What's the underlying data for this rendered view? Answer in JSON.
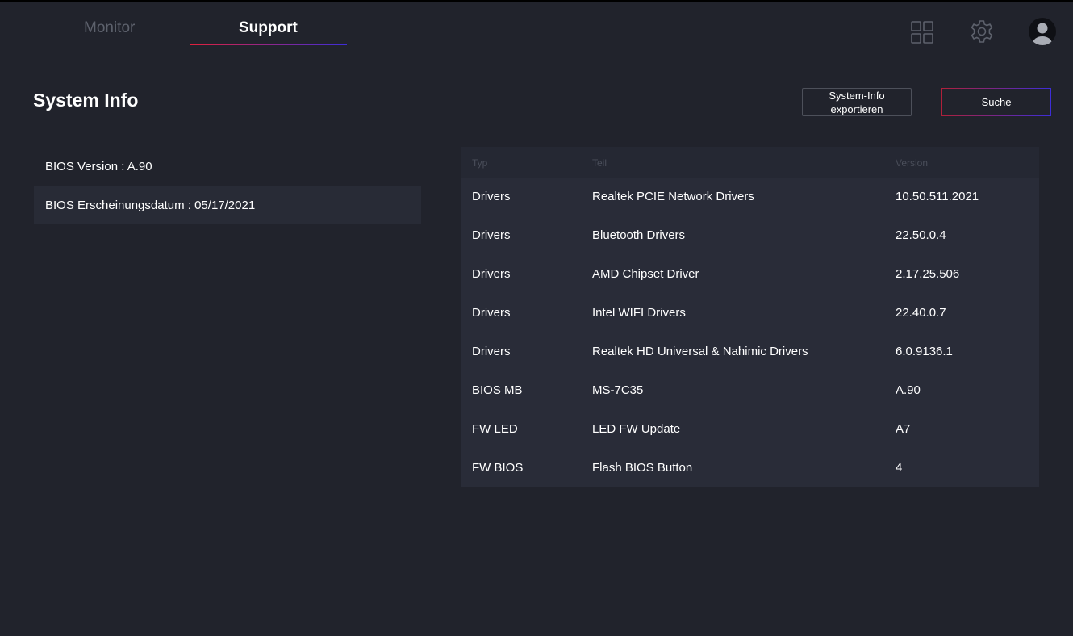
{
  "nav": {
    "tabs": [
      {
        "label": "Monitor"
      },
      {
        "label": "Support"
      }
    ],
    "active_tab": "Support",
    "icons": [
      "grid-icon",
      "gear-icon",
      "avatar-icon"
    ]
  },
  "header": {
    "title": "System Info",
    "export_label_line1": "System-Info",
    "export_label_line2": "exportieren",
    "search_label": "Suche"
  },
  "bios_info": [
    {
      "text": "BIOS Version : A.90"
    },
    {
      "text": "BIOS Erscheinungsdatum : 05/17/2021"
    }
  ],
  "table": {
    "columns": [
      "Typ",
      "Teil",
      "Version"
    ],
    "rows": [
      {
        "typ": "Drivers",
        "teil": "Realtek PCIE Network Drivers",
        "version": "10.50.511.2021"
      },
      {
        "typ": "Drivers",
        "teil": "Bluetooth Drivers",
        "version": "22.50.0.4"
      },
      {
        "typ": "Drivers",
        "teil": "AMD Chipset Driver",
        "version": "2.17.25.506"
      },
      {
        "typ": "Drivers",
        "teil": "Intel WIFI Drivers",
        "version": "22.40.0.7"
      },
      {
        "typ": "Drivers",
        "teil": "Realtek HD Universal & Nahimic Drivers",
        "version": "6.0.9136.1"
      },
      {
        "typ": "BIOS MB",
        "teil": "MS-7C35",
        "version": "A.90"
      },
      {
        "typ": "FW LED",
        "teil": "LED FW Update",
        "version": "A7"
      },
      {
        "typ": "FW BIOS",
        "teil": "Flash BIOS Button",
        "version": "4"
      }
    ]
  },
  "colors": {
    "background": "#21232c",
    "panel": "#292c38",
    "accent_red": "#e0203c",
    "accent_blue": "#3d2dd9",
    "muted_text": "#5d616c"
  }
}
